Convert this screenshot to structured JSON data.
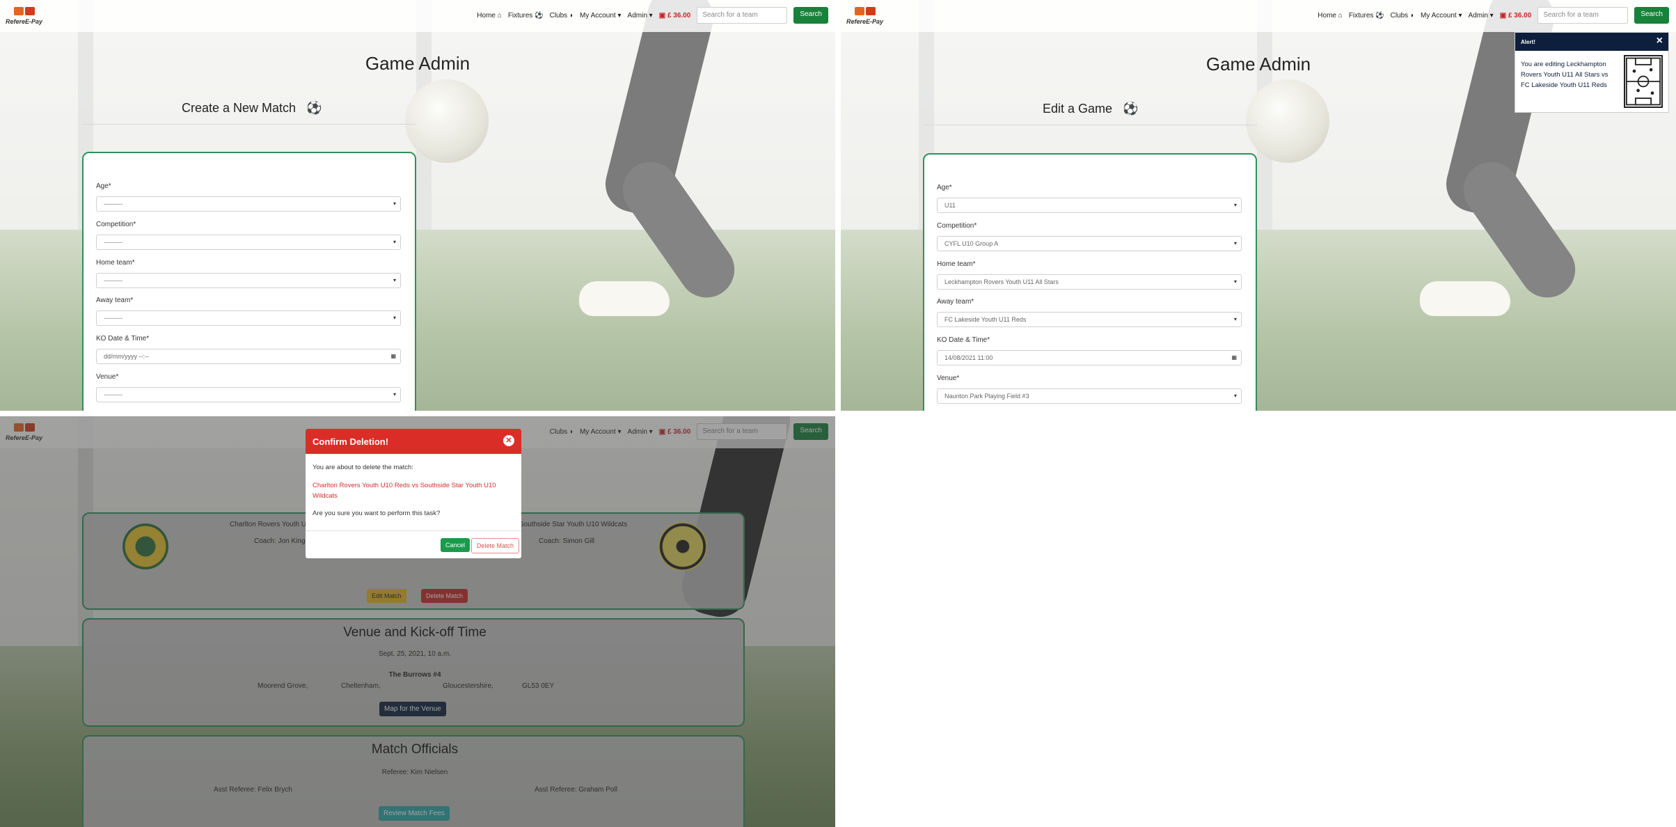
{
  "brand": "RefereE-Pay",
  "nav": {
    "home": "Home",
    "fixtures": "Fixtures",
    "clubs": "Clubs",
    "account": "My Account",
    "admin": "Admin",
    "cart": "£ 36.00",
    "search_placeholder": "Search for a team",
    "search_button": "Search"
  },
  "create": {
    "title": "Game Admin",
    "subtitle": "Create a New Match",
    "fields": [
      {
        "label": "Age*",
        "value": "---------"
      },
      {
        "label": "Competition*",
        "value": "---------"
      },
      {
        "label": "Home team*",
        "value": "---------"
      },
      {
        "label": "Away team*",
        "value": "---------"
      },
      {
        "label": "KO Date & Time*",
        "value": "dd/mm/yyyy --:--"
      },
      {
        "label": "Venue*",
        "value": "---------"
      }
    ]
  },
  "edit": {
    "title": "Game Admin",
    "subtitle": "Edit a Game",
    "fields": [
      {
        "label": "Age*",
        "value": "U11"
      },
      {
        "label": "Competition*",
        "value": "CYFL U10 Group A"
      },
      {
        "label": "Home team*",
        "value": "Leckhampton Rovers Youth U11 All Stars"
      },
      {
        "label": "Away team*",
        "value": "FC Lakeside Youth U11 Reds"
      },
      {
        "label": "KO Date & Time*",
        "value": "14/08/2021 11:00"
      },
      {
        "label": "Venue*",
        "value": "Naunton Park Playing Field #3"
      }
    ],
    "alert": {
      "title": "Alert!",
      "message": "You are editing Leckhampton Rovers Youth U11 All Stars vs FC Lakeside Youth U11 Reds"
    }
  },
  "detail": {
    "home_team": "Charlton Rovers Youth U10 Reds",
    "away_team": "Southside Star Youth U10 Wildcats",
    "home_coach": "Coach: Jon King",
    "away_coach": "Coach: Simon Gill",
    "edit_button": "Edit Match",
    "delete_button": "Delete Match",
    "venue_title": "Venue and Kick-off Time",
    "kickoff": "Sept. 25, 2021, 10 a.m.",
    "venue_name": "The Burrows #4",
    "address": [
      "Moorend Grove,",
      "Cheltenham,",
      "Gloucestershire,",
      "GL53 0EY"
    ],
    "map_button": "Map for the Venue",
    "officials_title": "Match Officials",
    "referee": "Referee: Kim Nielsen",
    "asst1": "Asst Referee: Felix Brych",
    "asst2": "Asst Referee: Graham Poll",
    "fees_button": "Review Match Fees"
  },
  "modal": {
    "title": "Confirm Deletion!",
    "line1": "You are about to delete the match:",
    "match": "Charlton Rovers Youth U10 Reds vs Southside Star Youth U10 Wildcats",
    "line2": "Are you sure you want to perform this task?",
    "cancel": "Cancel",
    "confirm": "Delete Match"
  }
}
